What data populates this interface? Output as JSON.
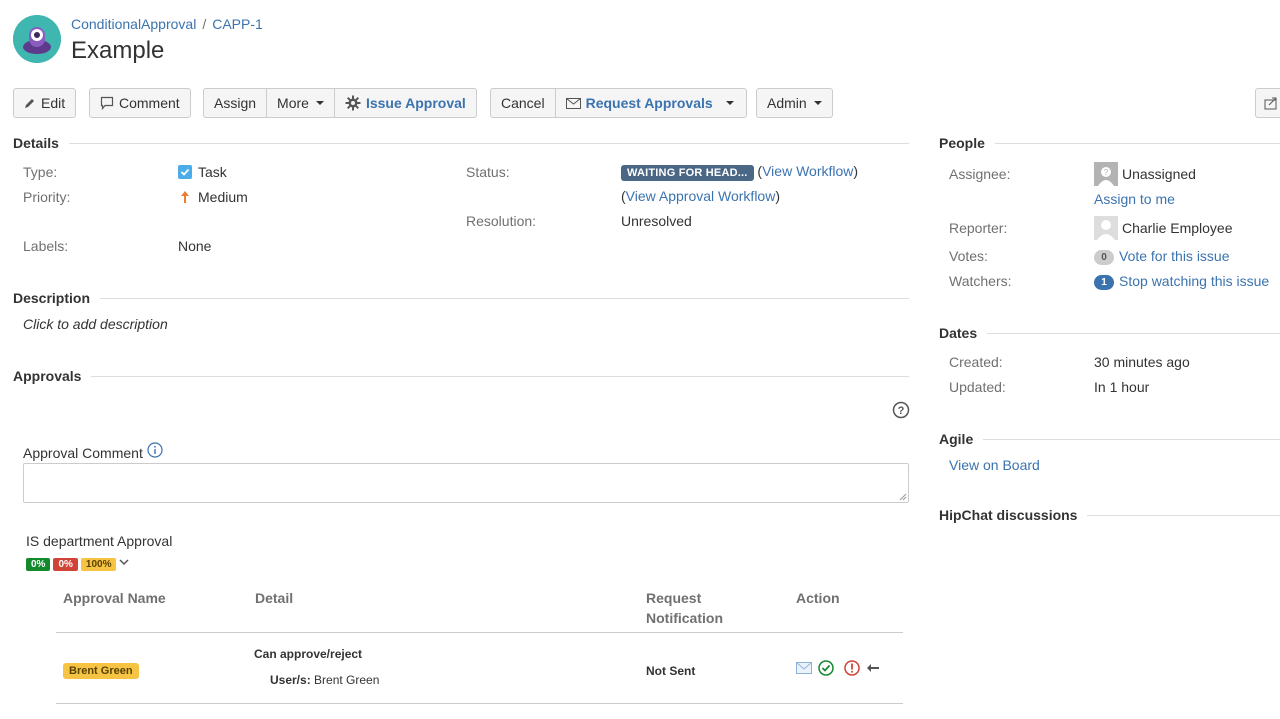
{
  "breadcrumb": {
    "project": "ConditionalApproval",
    "separator": "/",
    "issue_key": "CAPP-1"
  },
  "issue": {
    "title": "Example"
  },
  "toolbar": {
    "edit": "Edit",
    "comment": "Comment",
    "assign": "Assign",
    "more": "More",
    "issue_approval": "Issue Approval",
    "cancel": "Cancel",
    "request_approvals": "Request Approvals",
    "admin": "Admin"
  },
  "details": {
    "heading": "Details",
    "type_label": "Type:",
    "type_value": "Task",
    "priority_label": "Priority:",
    "priority_value": "Medium",
    "labels_label": "Labels:",
    "labels_value": "None",
    "status_label": "Status:",
    "status_value": "WAITING FOR HEAD...",
    "view_workflow": "View Workflow",
    "view_approval_workflow": "View Approval Workflow",
    "resolution_label": "Resolution:",
    "resolution_value": "Unresolved"
  },
  "description": {
    "heading": "Description",
    "placeholder": "Click to add description"
  },
  "approvals": {
    "heading": "Approvals",
    "comment_label": "Approval Comment",
    "group_name": "IS department Approval",
    "pct_approved": "0%",
    "pct_rejected": "0%",
    "pct_pending": "100%",
    "columns": [
      "Approval Name",
      "Detail",
      "Request Notification",
      "Action"
    ],
    "rows": [
      {
        "name": "Brent Green",
        "detail_title": "Can approve/reject",
        "detail_users_label": "User/s:",
        "detail_users": "Brent Green",
        "notification": "Not Sent"
      }
    ]
  },
  "people": {
    "heading": "People",
    "assignee_label": "Assignee:",
    "assignee_value": "Unassigned",
    "assign_to_me": "Assign to me",
    "reporter_label": "Reporter:",
    "reporter_value": "Charlie Employee",
    "votes_label": "Votes:",
    "votes_count": "0",
    "vote_link": "Vote for this issue",
    "watchers_label": "Watchers:",
    "watchers_count": "1",
    "watch_link": "Stop watching this issue"
  },
  "dates": {
    "heading": "Dates",
    "created_label": "Created:",
    "created_value": "30 minutes ago",
    "updated_label": "Updated:",
    "updated_value": "In 1 hour"
  },
  "agile": {
    "heading": "Agile",
    "view_on_board": "View on Board"
  },
  "hipchat": {
    "heading": "HipChat discussions"
  },
  "colors": {
    "link": "#3b73af",
    "status": "#4a6785",
    "approved": "#14892c",
    "rejected": "#d04437",
    "pending": "#f6c342"
  }
}
